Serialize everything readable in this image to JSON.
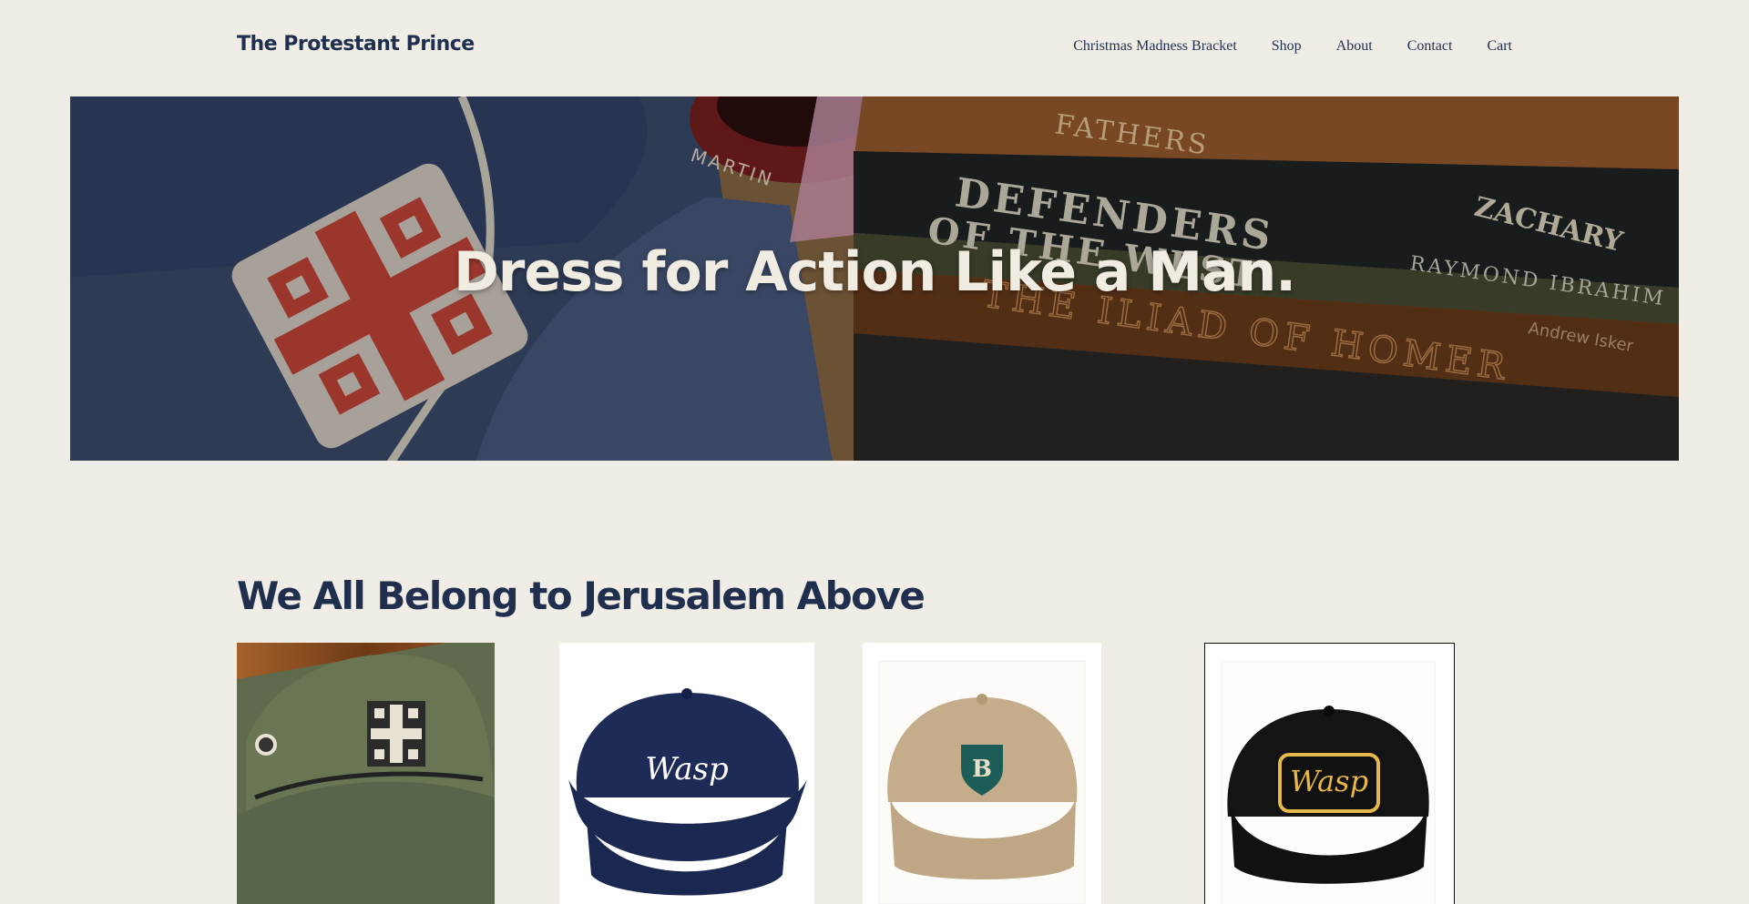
{
  "header": {
    "site_title": "The Protestant Prince",
    "nav": [
      {
        "label": "Christmas Madness Bracket"
      },
      {
        "label": "Shop"
      },
      {
        "label": "About"
      },
      {
        "label": "Contact"
      },
      {
        "label": "Cart"
      }
    ]
  },
  "hero": {
    "headline": "Dress for Action Like a Man.",
    "book_spines": [
      "FATHERS",
      "DEFENDERS",
      "OF THE WEST",
      "RAYMOND IBRAHIM",
      "ZACHARY",
      "THE ILIAD OF HOMER",
      "Andrew Isker",
      "MARTIN"
    ]
  },
  "section": {
    "title": "We All Belong to Jerusalem Above"
  },
  "products": [
    {
      "cap_color": "olive-green",
      "emblem": "jerusalem-cross"
    },
    {
      "cap_color": "navy",
      "emblem_text": "Wasp"
    },
    {
      "cap_color": "khaki",
      "emblem_text": "B"
    },
    {
      "cap_color": "black",
      "emblem_text": "Wasp"
    }
  ],
  "colors": {
    "background": "#efede6",
    "brand_navy": "#1f2f4d",
    "hero_text": "#f1ece2"
  }
}
